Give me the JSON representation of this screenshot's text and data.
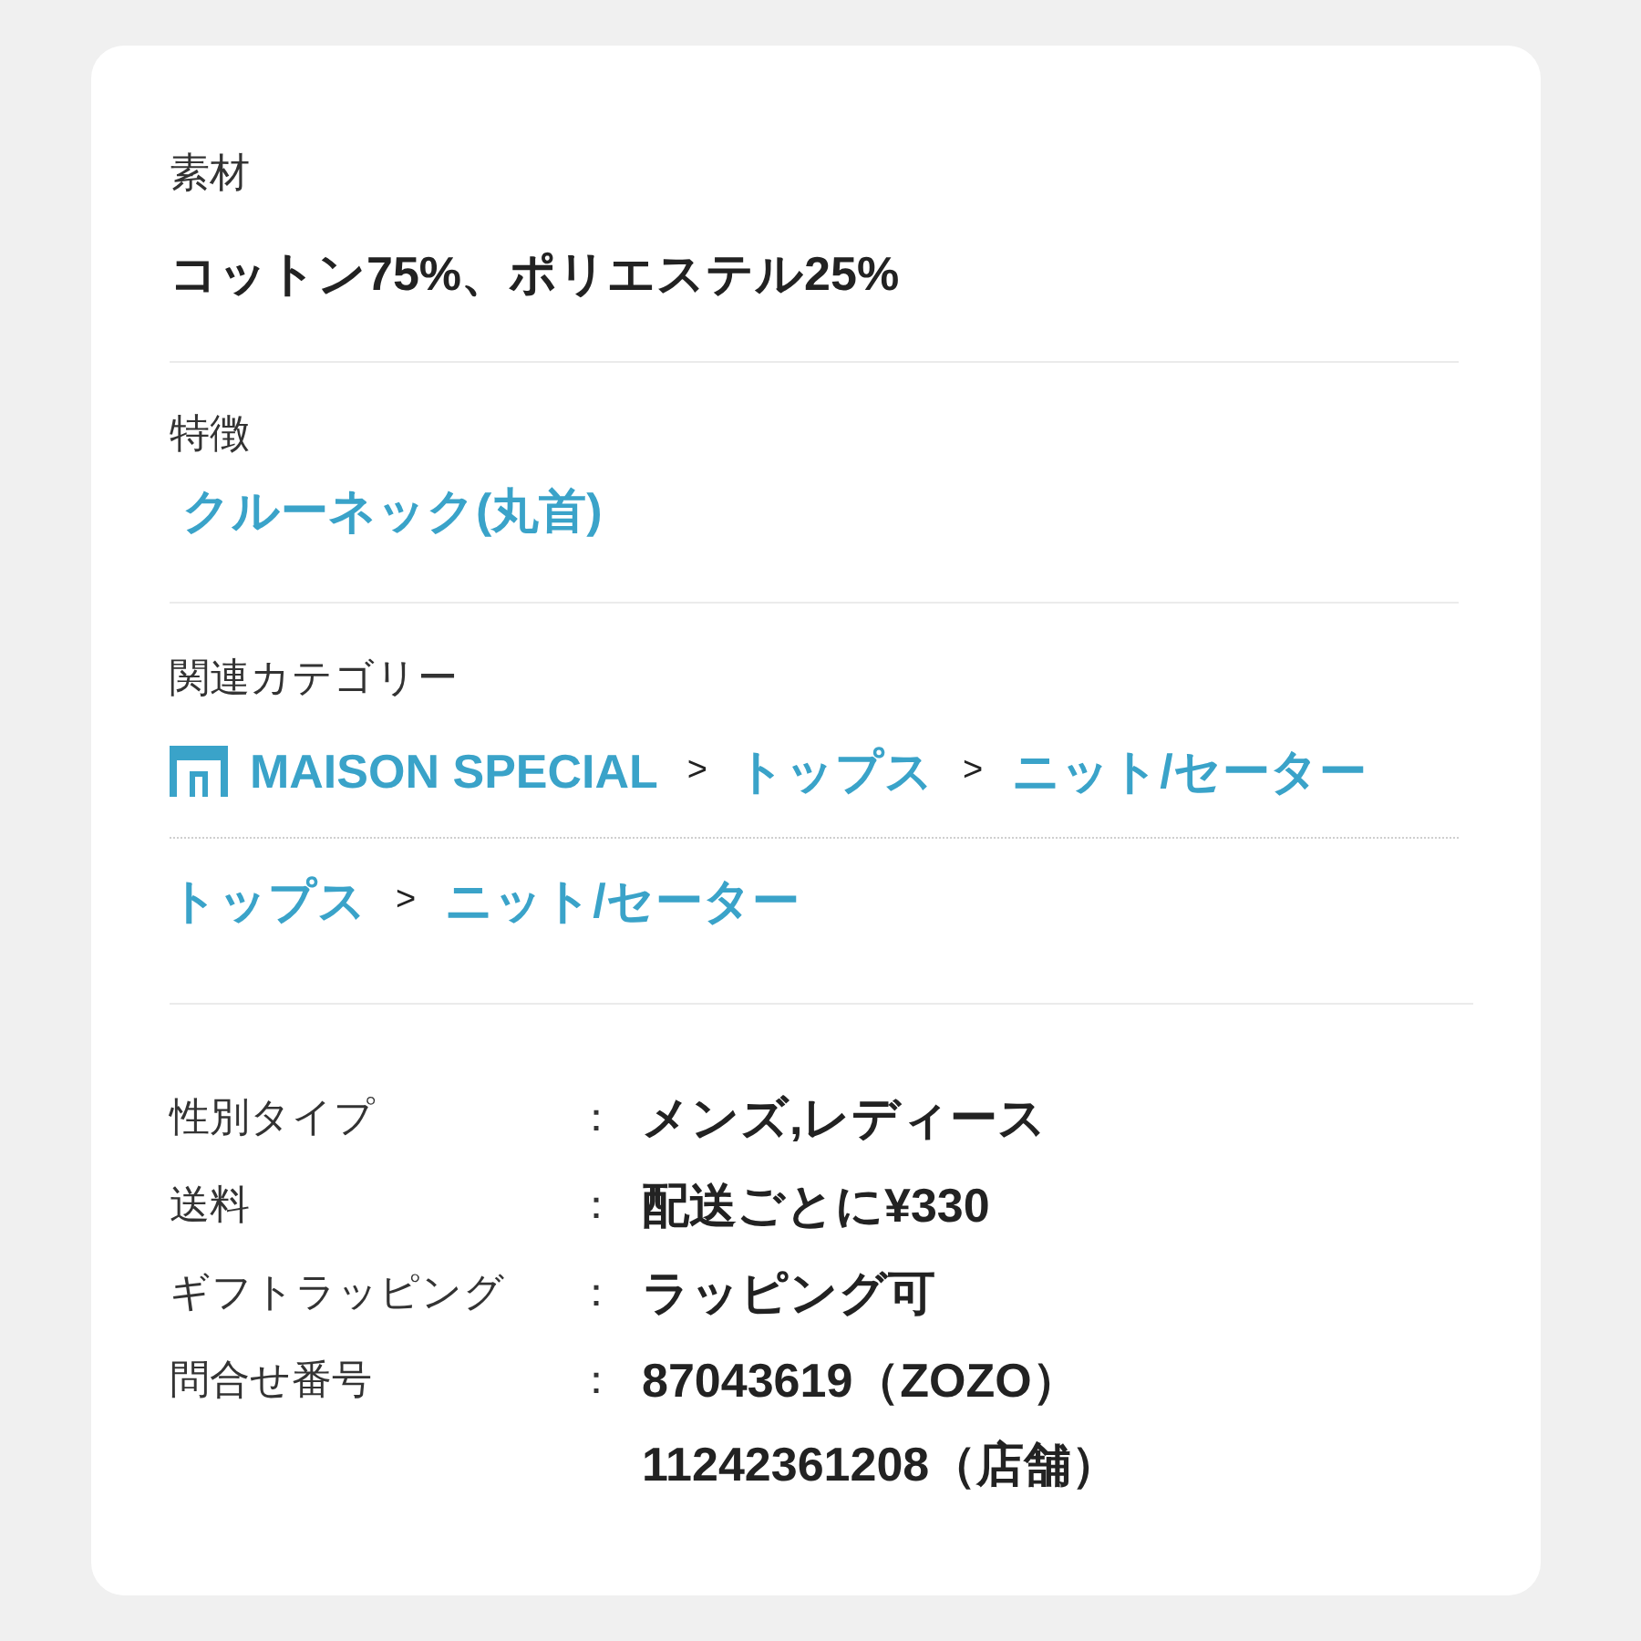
{
  "sections": [
    {
      "kind": "text",
      "label": "素材",
      "value": "コットン75%、ポリエステル25%"
    },
    {
      "kind": "links",
      "label": "特徴",
      "links": [
        "クルーネック(丸首)"
      ]
    },
    {
      "kind": "paths",
      "label": "関連カテゴリー",
      "paths": [
        [
          {
            "kind": "shop",
            "text": "MAISON SPECIAL"
          },
          {
            "kind": "separator",
            "text": ">"
          },
          {
            "kind": "link",
            "text": "トップス"
          },
          {
            "kind": "separator",
            "text": ">"
          },
          {
            "kind": "link",
            "text": "ニット/セーター"
          }
        ],
        [
          {
            "kind": "link",
            "text": "トップス"
          },
          {
            "kind": "separator",
            "text": ">"
          },
          {
            "kind": "link",
            "text": "ニット/セーター"
          }
        ]
      ]
    }
  ],
  "details": [
    {
      "label": "性別タイプ",
      "colon": "：",
      "values": [
        "メンズ,レディース"
      ]
    },
    {
      "label": "送料",
      "colon": "：",
      "values": [
        "配送ごとに¥330"
      ]
    },
    {
      "label": "ギフトラッピング",
      "colon": "：",
      "values": [
        "ラッピング可"
      ]
    },
    {
      "label": "問合せ番号",
      "colon": "：",
      "values": [
        "87043619（ZOZO）",
        "11242361208（店舗）"
      ]
    }
  ]
}
